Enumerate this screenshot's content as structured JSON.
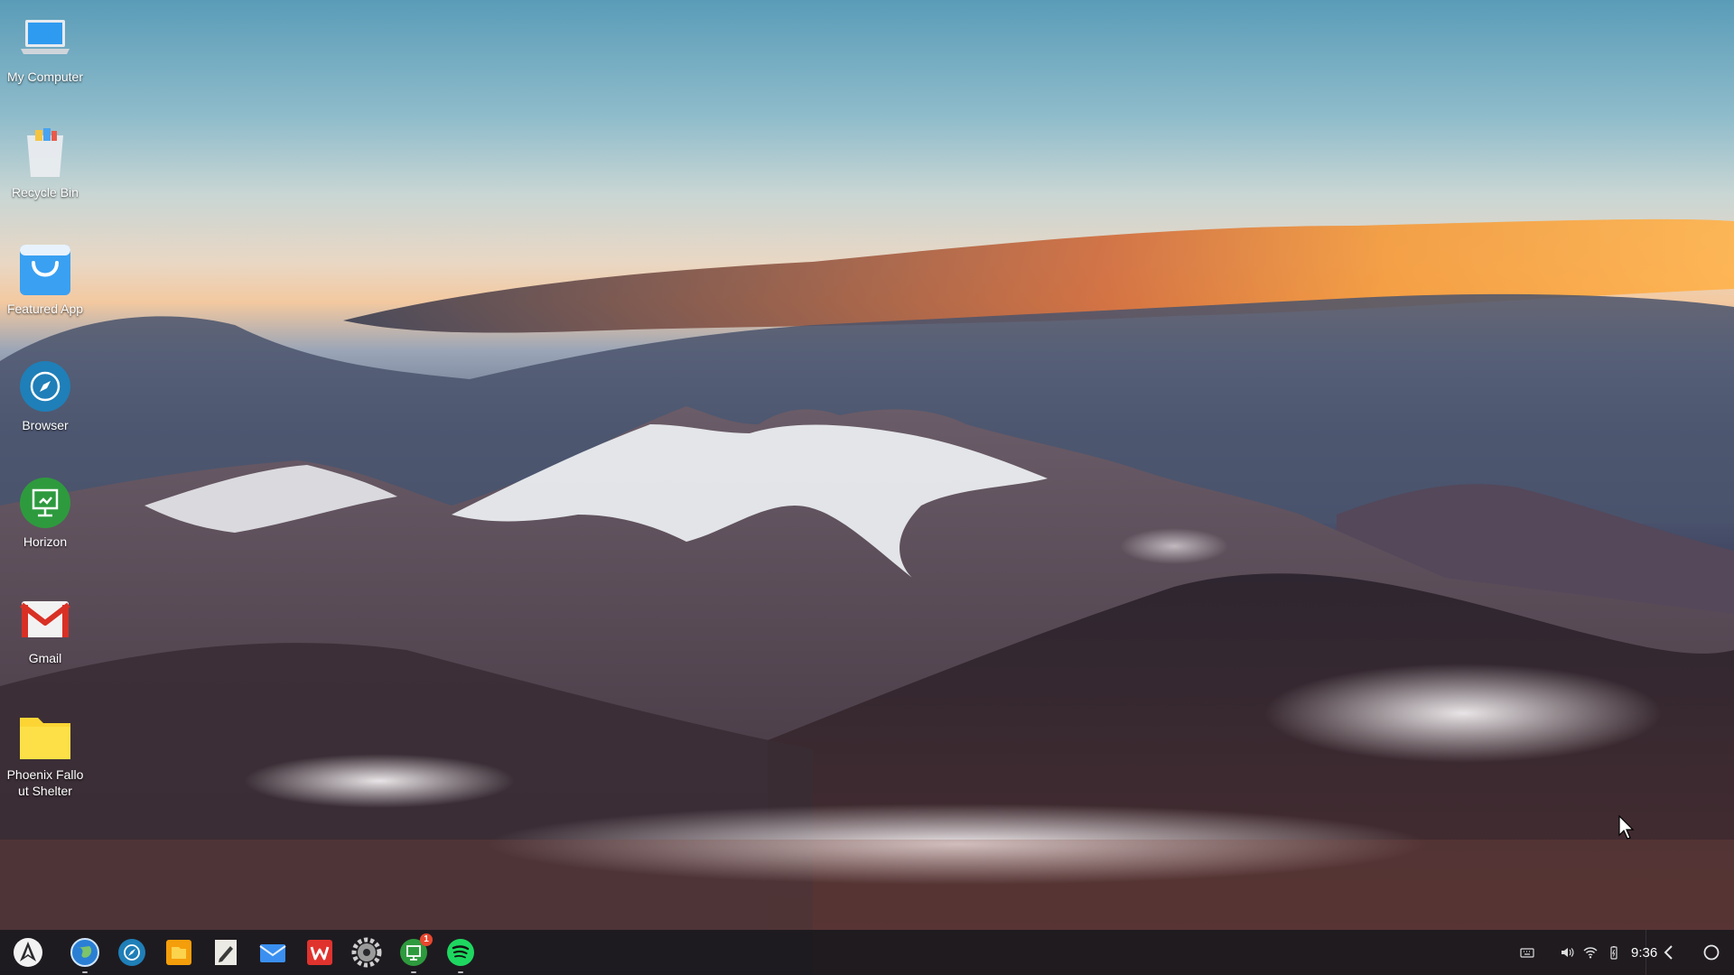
{
  "desktop": {
    "icons": [
      {
        "label": "My Computer",
        "icon": "laptop-icon"
      },
      {
        "label": "Recycle Bin",
        "icon": "recycle-bin-icon"
      },
      {
        "label": "Featured App",
        "icon": "shopping-bag-icon"
      },
      {
        "label": "Browser",
        "icon": "compass-icon"
      },
      {
        "label": "Horizon",
        "icon": "horizon-icon"
      },
      {
        "label": "Gmail",
        "icon": "gmail-icon"
      },
      {
        "label": "Phoenix Fallout Shelter",
        "icon": "folder-icon"
      }
    ]
  },
  "taskbar": {
    "start_icon": "phoenix-logo-icon",
    "pinned": [
      {
        "name": "chrome",
        "icon": "globe-icon"
      },
      {
        "name": "browser",
        "icon": "compass-icon"
      },
      {
        "name": "files",
        "icon": "file-manager-icon"
      },
      {
        "name": "editor",
        "icon": "notepad-icon"
      },
      {
        "name": "mail",
        "icon": "mail-icon"
      },
      {
        "name": "wps",
        "icon": "wps-office-icon"
      },
      {
        "name": "settings",
        "icon": "gear-icon"
      },
      {
        "name": "horizon",
        "icon": "horizon-icon",
        "badge": "1"
      },
      {
        "name": "spotify",
        "icon": "spotify-icon"
      }
    ],
    "tray": {
      "clock": "9:36"
    }
  },
  "colors": {
    "taskbar_bg": "#1c1a1e",
    "badge": "#e8472f",
    "folder": "#fcd535",
    "horizon": "#2e9a3e"
  }
}
